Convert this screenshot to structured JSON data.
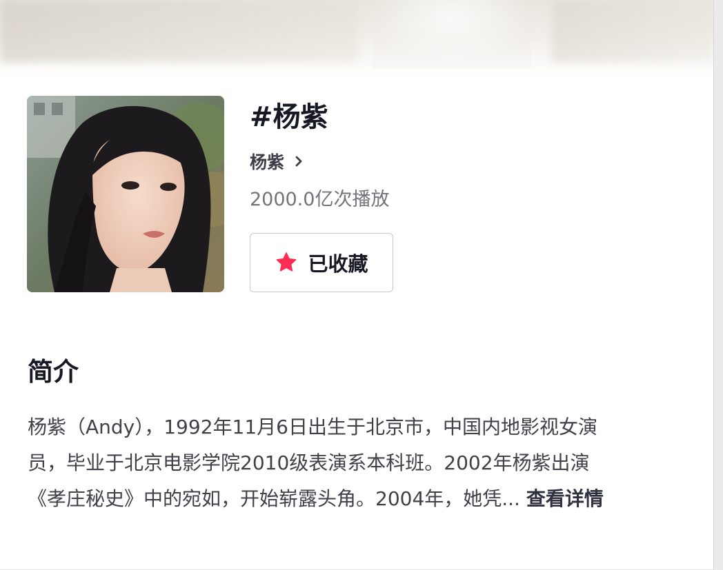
{
  "topic": {
    "title": "#杨紫",
    "author_name": "杨紫",
    "play_count": "2000.0亿次播放",
    "favorite_button_label": "已收藏",
    "favorite_state": "favorited"
  },
  "intro": {
    "heading": "简介",
    "lines": [
      "杨紫（Andy），1992年11月6日出生于北京市，中国内地影视女演",
      "员，毕业于北京电影学院2010级表演系本科班。2002年杨紫出演",
      "《孝庄秘史》中的宛如，开始崭露头角。2004年，她凭..."
    ],
    "see_more": "查看详情"
  },
  "icons": {
    "author_arrow": "chevron-right-icon",
    "favorite": "star-filled-icon"
  },
  "colors": {
    "star": "#fe2c55",
    "title_text": "#161823",
    "secondary_text": "#73747b",
    "button_border": "#c9c9cc"
  }
}
